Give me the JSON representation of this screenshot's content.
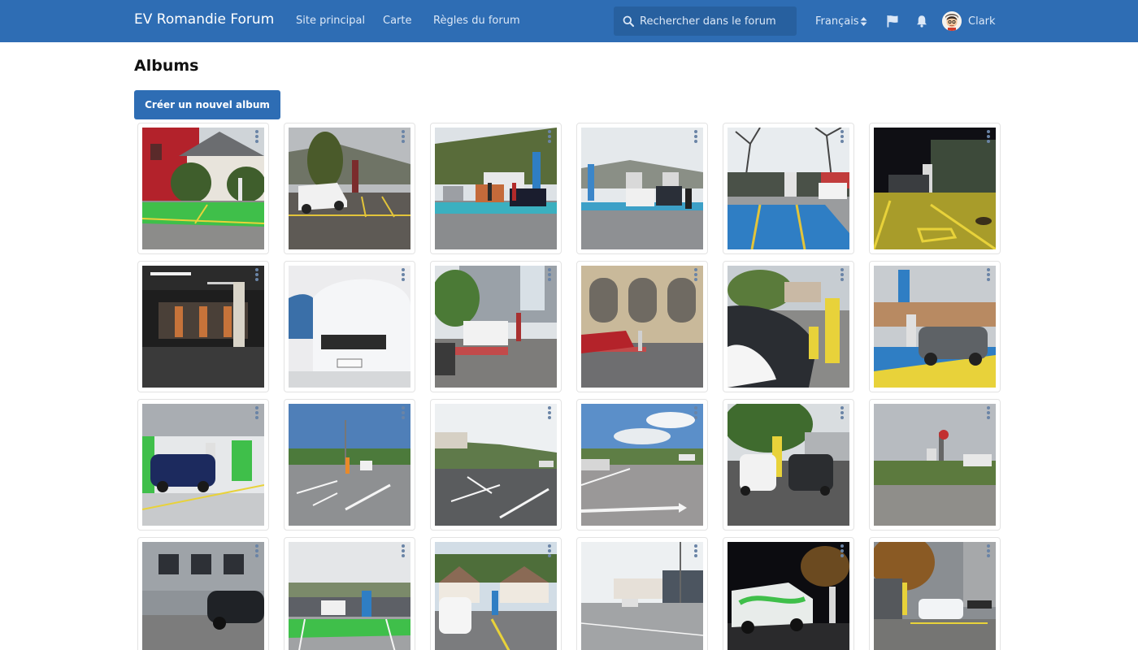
{
  "nav": {
    "brand": "EV Romandie Forum",
    "links": [
      "Site principal",
      "Carte",
      "Règles du forum"
    ],
    "search_placeholder": "Rechercher dans le forum",
    "language": "Français",
    "username": "Clark",
    "colors": {
      "bar": "#2e6db4",
      "search_bg": "#27609f"
    },
    "icons": [
      "search-icon",
      "sort-caret-icon",
      "flag-icon",
      "bell-icon",
      "avatar"
    ]
  },
  "page": {
    "title": "Albums",
    "create_button": "Créer un nouvel album"
  },
  "albums": [
    {
      "id": 1
    },
    {
      "id": 2
    },
    {
      "id": 3
    },
    {
      "id": 4
    },
    {
      "id": 5
    },
    {
      "id": 6
    },
    {
      "id": 7
    },
    {
      "id": 8
    },
    {
      "id": 9
    },
    {
      "id": 10
    },
    {
      "id": 11
    },
    {
      "id": 12
    },
    {
      "id": 13
    },
    {
      "id": 14
    },
    {
      "id": 15
    },
    {
      "id": 16
    },
    {
      "id": 17
    },
    {
      "id": 18
    },
    {
      "id": 19
    },
    {
      "id": 20
    },
    {
      "id": 21
    },
    {
      "id": 22
    },
    {
      "id": 23
    },
    {
      "id": 24
    }
  ]
}
